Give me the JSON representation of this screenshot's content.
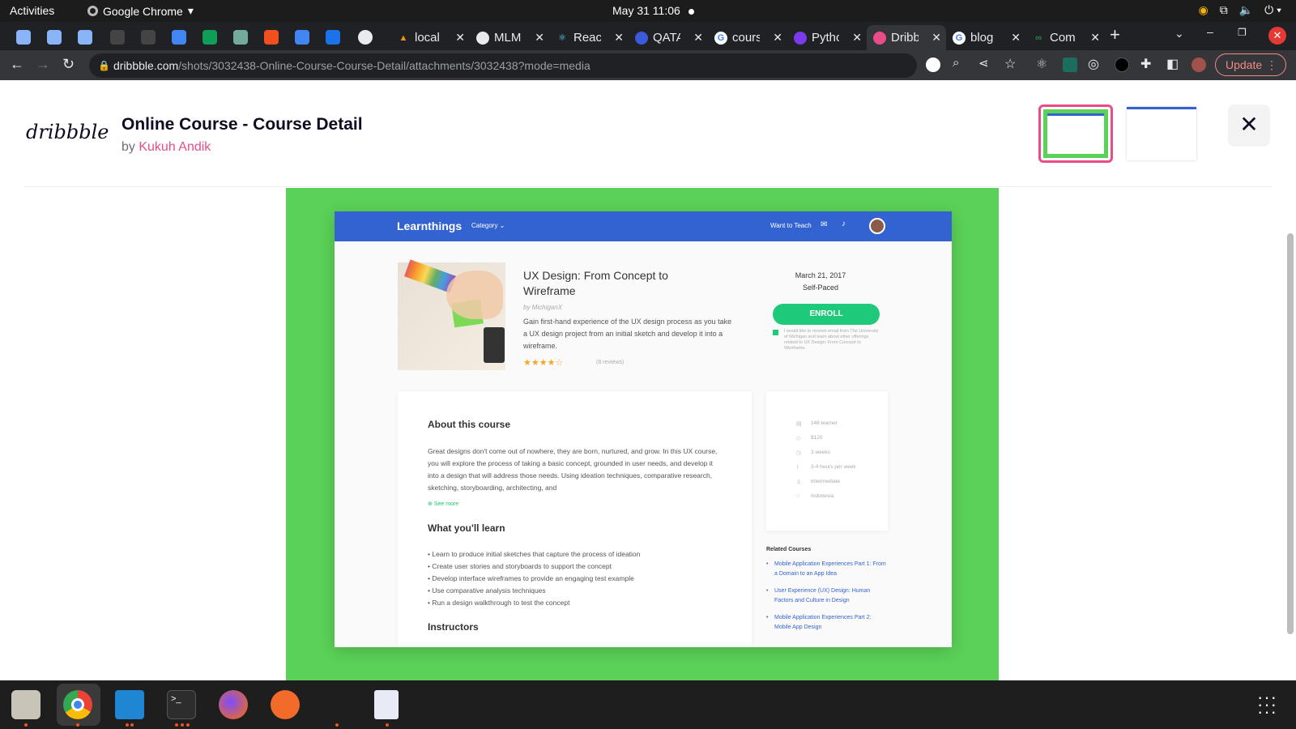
{
  "system_bar": {
    "activities": "Activities",
    "app_name": "Google Chrome",
    "clock": "May 31  11:06"
  },
  "tabs": [
    {
      "label": "local",
      "icon": "triangle-icon"
    },
    {
      "label": "MLM",
      "icon": "globe-icon"
    },
    {
      "label": "React",
      "icon": "react-icon"
    },
    {
      "label": "QATA",
      "icon": "shield-icon"
    },
    {
      "label": "cours",
      "icon": "google-icon"
    },
    {
      "label": "Pytho",
      "icon": "python-icon"
    },
    {
      "label": "Dribb",
      "icon": "dribbble-icon"
    },
    {
      "label": "blog",
      "icon": "google-icon"
    },
    {
      "label": "Com",
      "icon": "link-icon"
    }
  ],
  "omnibox": {
    "domain": "dribbble.com",
    "path": "/shots/3032438-Online-Course-Course-Detail/attachments/3032438?mode=media"
  },
  "update_label": "Update",
  "shot": {
    "logo": "dribbble",
    "title": "Online Course - Course Detail",
    "by_prefix": "by ",
    "author": "Kukuh Andik"
  },
  "course": {
    "brand": "Learnthings",
    "category": "Category ⌄",
    "want_to_teach": "Want to Teach",
    "title": "UX Design: From Concept to Wireframe",
    "by": "by MichiganX",
    "description": "Gain first-hand experience of the UX design process as you take a UX design project from an initial sketch and develop it into a wireframe.",
    "rating_stars": "★★★★☆",
    "reviews": "(8 reviews)",
    "date": "March 21, 2017",
    "pace": "Self-Paced",
    "enroll": "ENROLL",
    "email_opt_in": "I would like to receive email from The University of Michigan and learn about other offerings related to UX Design: From Concept to Wireframe.",
    "about_heading": "About this course",
    "about_text": "Great designs don't come out of nowhere, they are born, nurtured, and grow. In this UX course, you will explore the process of taking a basic concept, grounded in user needs, and develop it into a design that will address those needs. Using ideation techniques, comparative research, sketching, storyboarding, architecting, and",
    "see_more": "See more",
    "learn_heading": "What you'll learn",
    "learn_items": [
      "Learn to produce initial sketches that capture the process of ideation",
      "Create user stories and storyboards to support the concept",
      "Develop interface wireframes to provide an engaging test example",
      "Use comparative analysis techniques",
      "Run a design walkthrough to test the concept"
    ],
    "instructors_heading": "Instructors",
    "facts": [
      "146 learner",
      "$120",
      "3 weeks",
      "3-4 hours per week",
      "Intermediate",
      "Indonesia"
    ],
    "related_heading": "Related Courses",
    "related": [
      "Mobile Application Experiences Part 1: From a Domain to an App Idea",
      "User Experience (UX) Design: Human Factors and Culture in Design",
      "Mobile Application Experiences Part 2: Mobile App Design"
    ]
  },
  "colors": {
    "shot_bg": "#5ad157",
    "nav_blue": "#3363d1",
    "enroll_green": "#1fc97a",
    "dribbble_pink": "#ea4c89"
  }
}
